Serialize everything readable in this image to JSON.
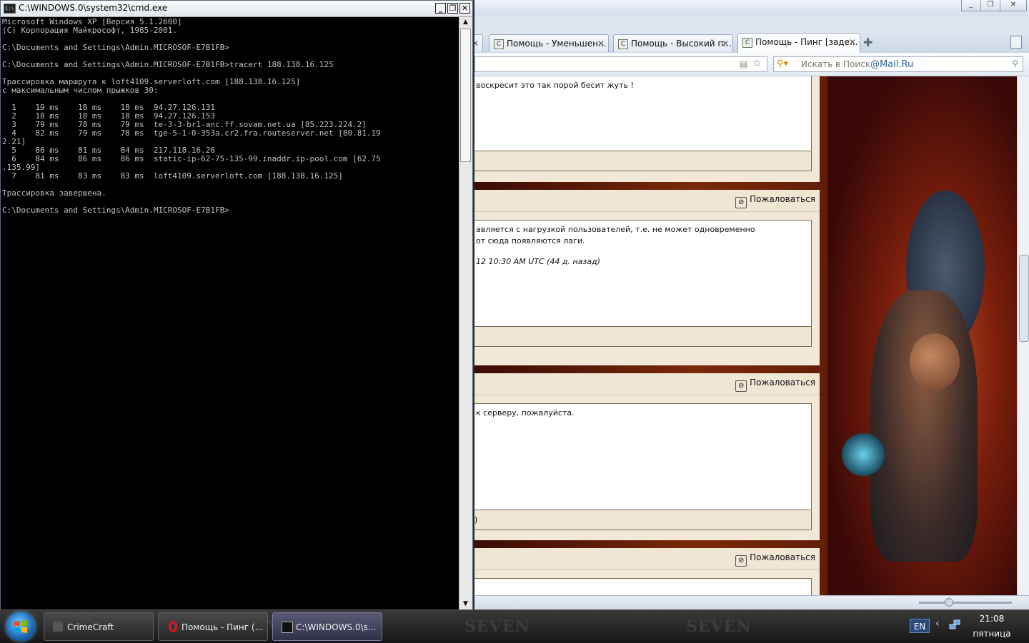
{
  "browser": {
    "tabs": [
      {
        "label": "Помощь - Уменьшен..."
      },
      {
        "label": "Помощь - Высокий п..."
      },
      {
        "label": "Помощь - Пинг [заде..."
      }
    ],
    "search_placeholder": "Искать в Поиск",
    "search_brand": "@Mail.Ru",
    "report_label": "Пожаловаться",
    "posts": [
      {
        "text_lines": [
          "воскресит это так порой бесит жуть !"
        ],
        "footer": ""
      },
      {
        "text_lines": [
          "авляется с нагрузкой пользователей, т.е. не может одновременно",
          "от сюда появляются лаги."
        ],
        "timestamp": "12 10:30 AM UTC (44 д. назад)",
        "footer": ""
      },
      {
        "text_lines": [
          "к серверу, пожалуйста."
        ],
        "footer": ")"
      },
      {
        "text_lines": [],
        "footer": ""
      }
    ]
  },
  "cmd": {
    "title": "C:\\WINDOWS.0\\system32\\cmd.exe",
    "lines": [
      "Microsoft Windows XP [Версия 5.1.2600]",
      "(С) Корпорация Майкрософт, 1985-2001.",
      "",
      "C:\\Documents and Settings\\Admin.MICROSOF-E7B1FB>",
      "",
      "C:\\Documents and Settings\\Admin.MICROSOF-E7B1FB>tracert 188.138.16.125",
      "",
      "Трассировка маршрута к loft4109.serverloft.com [188.138.16.125]",
      "с максимальным числом прыжков 30:",
      "",
      "  1    19 ms    18 ms    18 ms  94.27.126.131",
      "  2    18 ms    18 ms    18 ms  94.27.126.153",
      "  3    79 ms    78 ms    79 ms  te-3-3-br1-anc.ff.sovam.net.ua [85.223.224.2]",
      "  4    82 ms    79 ms    78 ms  tge-5-1-0-353a.cr2.fra.routeserver.net [80.81.19",
      "2.21]",
      "  5    80 ms    81 ms    84 ms  217.118.16.26",
      "  6    84 ms    86 ms    86 ms  static-ip-62-75-135-99.inaddr.ip-pool.com [62.75",
      ".135.99]",
      "  7    81 ms    83 ms    83 ms  loft4109.serverloft.com [188.138.16.125]",
      "",
      "Трассировка завершена.",
      "",
      "C:\\Documents and Settings\\Admin.MICROSOF-E7B1FB>"
    ]
  },
  "taskbar": {
    "buttons": [
      {
        "label": "CrimeCraft"
      },
      {
        "label": "Помощь - Пинг (..."
      },
      {
        "label": "C:\\WINDOWS.0\\s..."
      }
    ],
    "watermark": "SEVEN",
    "language": "EN",
    "time": "21:08",
    "day": "пятница"
  },
  "colors": {
    "cmd_text": "#c0c0c0",
    "cmd_bg": "#000000",
    "accent": "#2d5f9a"
  }
}
